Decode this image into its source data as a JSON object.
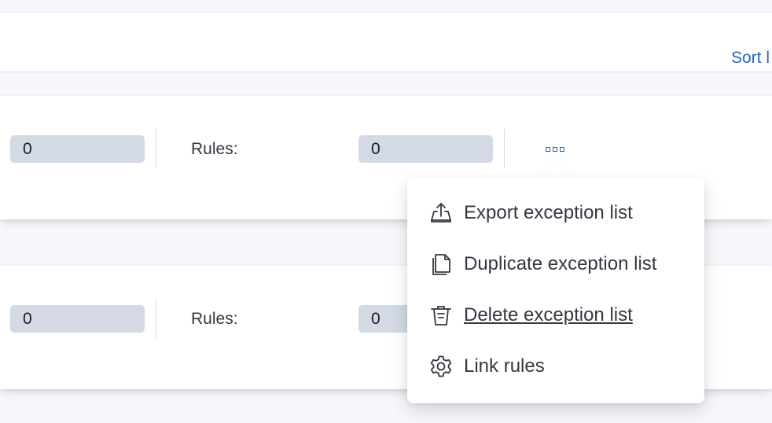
{
  "header": {
    "sort_label": "Sort l"
  },
  "cards": [
    {
      "exceptions_count": "0",
      "rules_label": "Rules:",
      "rules_count": "0"
    },
    {
      "exceptions_count": "0",
      "rules_label": "Rules:",
      "rules_count": "0"
    }
  ],
  "actions_menu": {
    "button_icon": "boxes-horizontal-icon",
    "items": [
      {
        "label": "Export exception list",
        "icon": "export-icon"
      },
      {
        "label": "Duplicate exception list",
        "icon": "copy-icon"
      },
      {
        "label": "Delete exception list",
        "icon": "trash-icon"
      },
      {
        "label": "Link rules",
        "icon": "gear-icon"
      }
    ]
  },
  "colors": {
    "link": "#1f6ab9",
    "badge_bg": "#d3dae6",
    "text": "#343741"
  }
}
